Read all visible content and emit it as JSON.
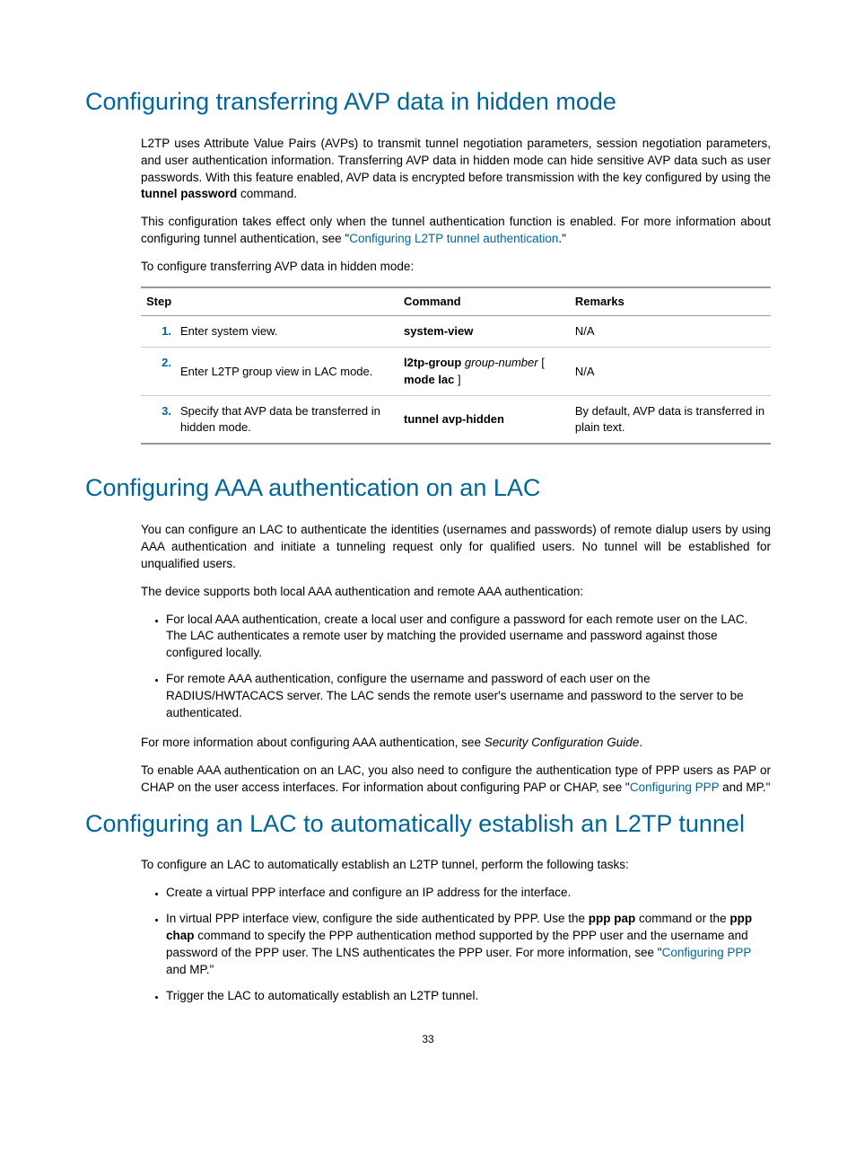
{
  "page_number": "33",
  "section1": {
    "heading": "Configuring transferring AVP data in hidden mode",
    "p1_pre": "L2TP uses Attribute Value Pairs (AVPs) to transmit tunnel negotiation parameters, session negotiation parameters, and user authentication information. Transferring AVP data in hidden mode can hide sensitive AVP data such as user passwords. With this feature enabled, AVP data is encrypted before transmission with the key configured by using the ",
    "p1_bold": "tunnel password",
    "p1_post": " command.",
    "p2_pre": "This configuration takes effect only when the tunnel authentication function is enabled. For more information about configuring tunnel authentication, see \"",
    "p2_link": "Configuring L2TP tunnel authentication",
    "p2_post": ".\"",
    "p3": "To configure transferring AVP data in hidden mode:",
    "table": {
      "h_step": "Step",
      "h_cmd": "Command",
      "h_rem": "Remarks",
      "r1": {
        "num": "1.",
        "step": "Enter system view.",
        "cmd_b": "system-view",
        "rem": "N/A"
      },
      "r2": {
        "num": "2.",
        "step": "Enter L2TP group view in LAC mode.",
        "cmd_b1": "l2tp-group",
        "cmd_i": " group-number ",
        "cmd_t1": "[ ",
        "cmd_b2": "mode lac",
        "cmd_t2": " ]",
        "rem": "N/A"
      },
      "r3": {
        "num": "3.",
        "step": "Specify that AVP data be transferred in hidden mode.",
        "cmd_b": "tunnel avp-hidden",
        "rem": "By default, AVP data is transferred in plain text."
      }
    }
  },
  "section2": {
    "heading": "Configuring AAA authentication on an LAC",
    "p1": "You can configure an LAC to authenticate the identities (usernames and passwords) of remote dialup users by using AAA authentication and initiate a tunneling request only for qualified users. No tunnel will be established for unqualified users.",
    "p2": "The device supports both local AAA authentication and remote AAA authentication:",
    "li1": "For local AAA authentication, create a local user and configure a password for each remote user on the LAC. The LAC authenticates a remote user by matching the provided username and password against those configured locally.",
    "li2": "For remote AAA authentication, configure the username and password of each user on the RADIUS/HWTACACS server. The LAC sends the remote user's username and password to the server to be authenticated.",
    "p3_pre": "For more information about configuring AAA authentication, see ",
    "p3_i": "Security Configuration Guide",
    "p3_post": ".",
    "p4_pre": "To enable AAA authentication on an LAC, you also need to configure the authentication type of PPP users as PAP or CHAP on the user access interfaces. For information about configuring PAP or CHAP, see \"",
    "p4_link": "Configuring PPP",
    "p4_post": " and MP.\""
  },
  "section3": {
    "heading": "Configuring an LAC to automatically establish an L2TP tunnel",
    "p1": "To configure an LAC to automatically establish an L2TP tunnel, perform the following tasks:",
    "li1": "Create a virtual PPP interface and configure an IP address for the interface.",
    "li2_pre": "In virtual PPP interface view, configure the side authenticated by PPP. Use the ",
    "li2_b1": "ppp pap",
    "li2_mid": " command or the ",
    "li2_b2": "ppp chap",
    "li2_post1": " command to specify the PPP authentication method supported by the PPP user and the username and password of the PPP user. The LNS authenticates the PPP user. For more information, see \"",
    "li2_link": "Configuring PPP",
    "li2_post2": " and MP.\"",
    "li3": "Trigger the LAC to automatically establish an L2TP tunnel."
  }
}
